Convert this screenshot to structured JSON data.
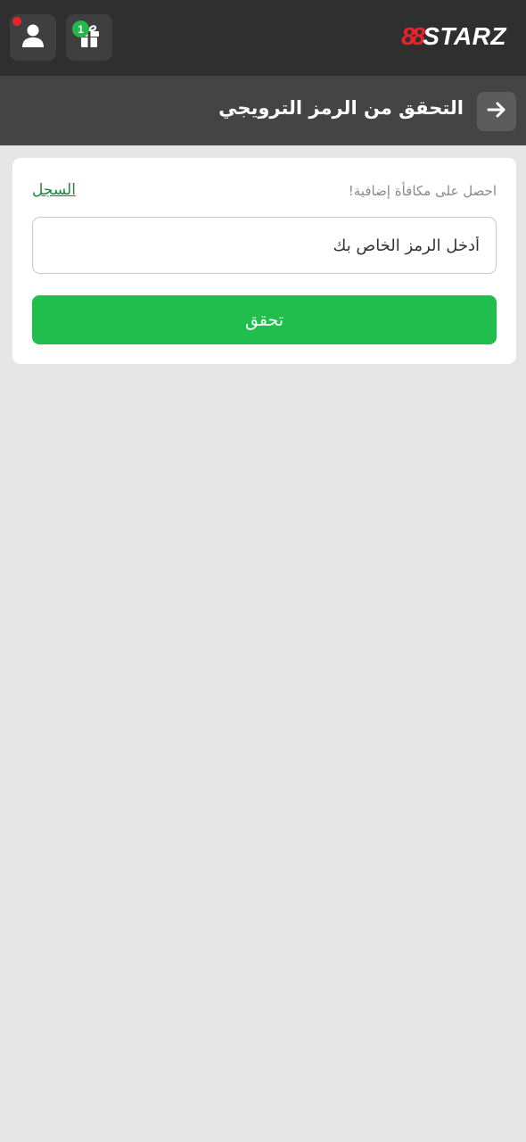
{
  "header": {
    "logo_mark": "88",
    "logo_text": "STARZ",
    "profile_icon": "user-icon",
    "gift_icon": "gift-icon",
    "gift_count": "1",
    "profile_has_notification": true
  },
  "subheader": {
    "back_icon": "arrow-right-icon",
    "title": "التحقق من الرمز الترويجي"
  },
  "card": {
    "bonus_text": "احصل على مكافأة إضافية!",
    "history_link": "السجل",
    "input_placeholder": "أدخل الرمز الخاص بك",
    "input_value": "",
    "verify_label": "تحقق"
  },
  "colors": {
    "accent_green": "#1fbe4d",
    "brand_red": "#e8242b",
    "header_bg": "#2f2f2f",
    "subheader_bg": "#444444",
    "page_bg": "#e6e6e6"
  }
}
